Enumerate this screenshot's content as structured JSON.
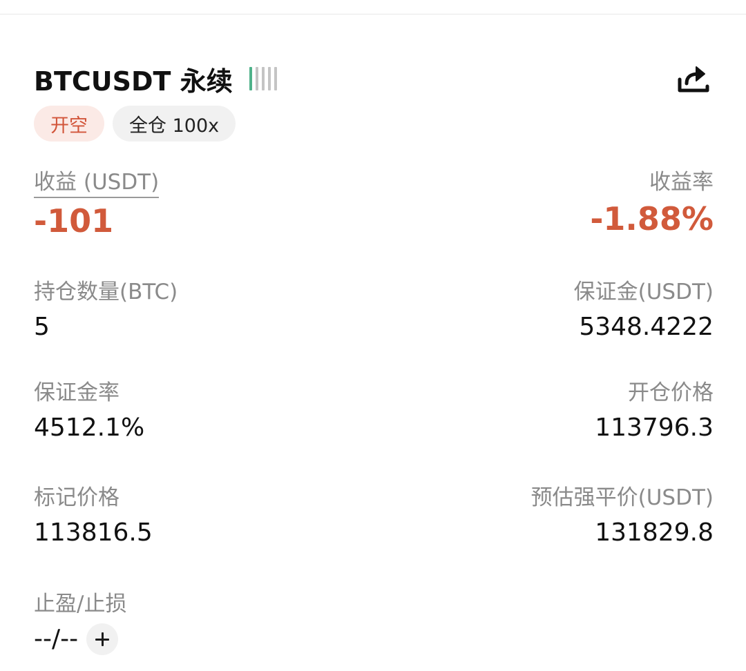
{
  "header": {
    "symbol": "BTCUSDT 永续",
    "signal_bars_total": 5,
    "signal_bars_active": 1,
    "share_icon": "share-icon"
  },
  "tags": {
    "side": "开空",
    "margin_mode": "全仓 100x"
  },
  "pnl": {
    "label": "收益 (USDT)",
    "value": "-101"
  },
  "roe": {
    "label": "收益率",
    "value": "-1.88%"
  },
  "size": {
    "label": "持仓数量(BTC)",
    "value": "5"
  },
  "margin": {
    "label": "保证金(USDT)",
    "value": "5348.4222"
  },
  "margin_ratio": {
    "label": "保证金率",
    "value": "4512.1%"
  },
  "entry_price": {
    "label": "开仓价格",
    "value": "113796.3"
  },
  "mark_price": {
    "label": "标记价格",
    "value": "113816.5"
  },
  "liq_price": {
    "label": "预估强平价(USDT)",
    "value": "131829.8"
  },
  "tpsl": {
    "label": "止盈/止损",
    "value": "--/--",
    "add_icon": "plus-icon"
  },
  "colors": {
    "loss": "#d15a3b",
    "signal_active": "#4fb28a",
    "tag_side_bg": "#fbeae6"
  }
}
